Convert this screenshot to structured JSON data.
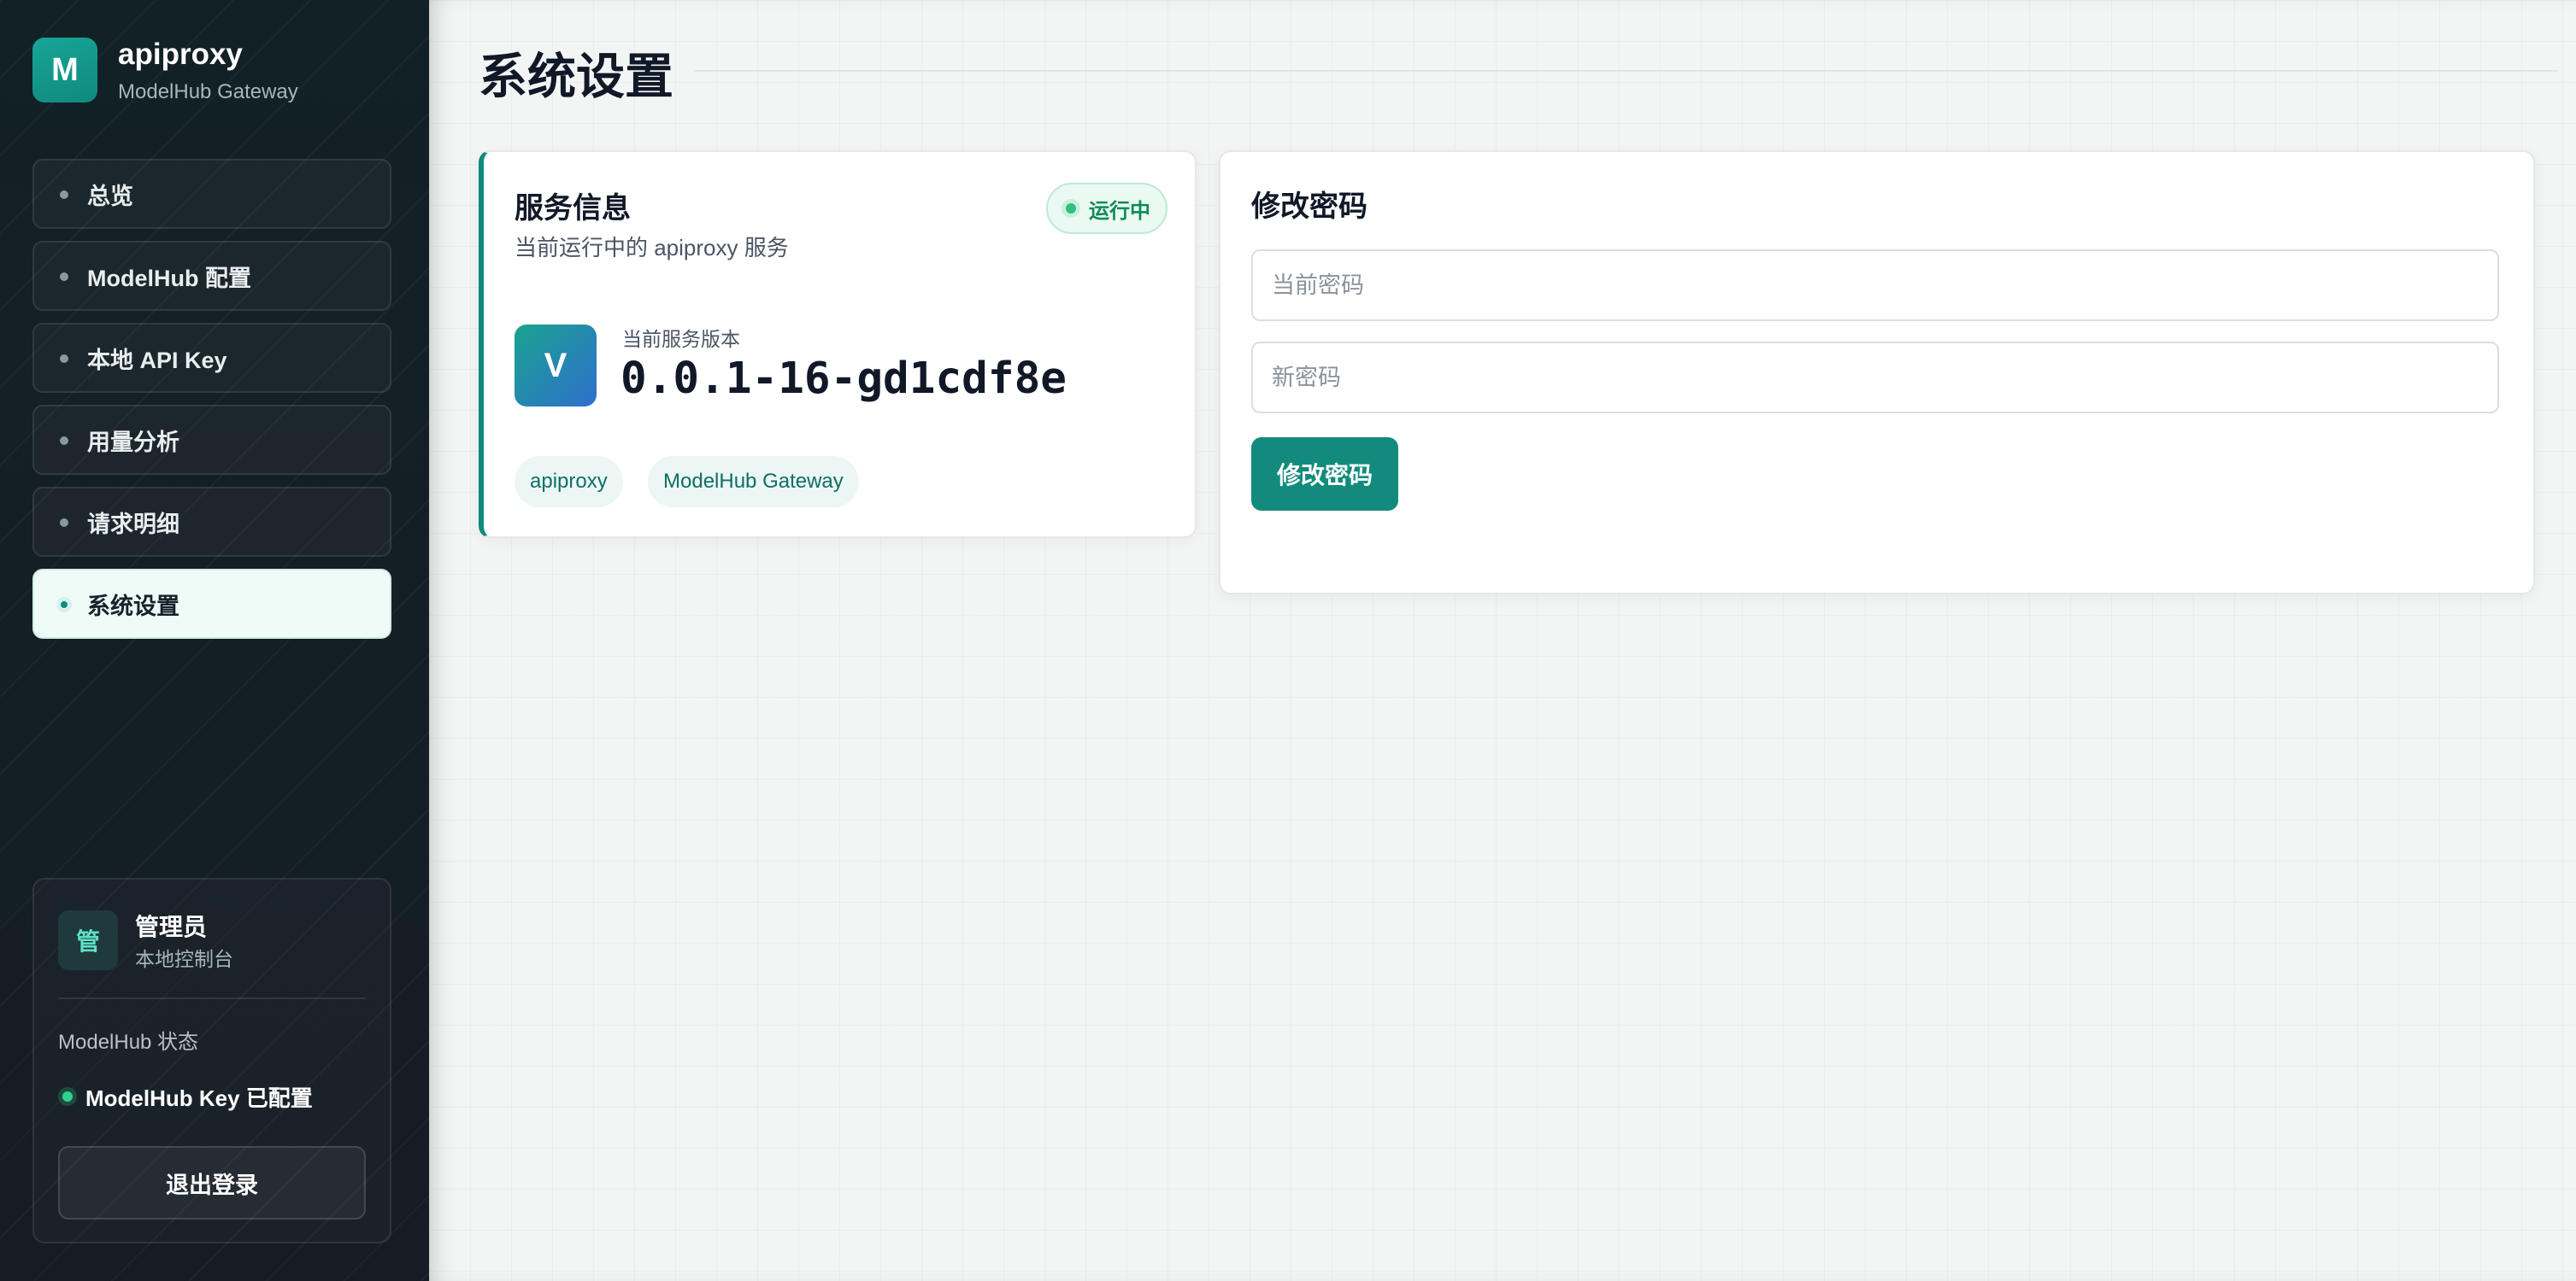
{
  "brand": {
    "logo_letter": "M",
    "name": "apiproxy",
    "subtitle": "ModelHub Gateway"
  },
  "sidebar": {
    "items": [
      {
        "label": "总览",
        "active": false
      },
      {
        "label": "ModelHub 配置",
        "active": false
      },
      {
        "label": "本地 API Key",
        "active": false
      },
      {
        "label": "用量分析",
        "active": false
      },
      {
        "label": "请求明细",
        "active": false
      },
      {
        "label": "系统设置",
        "active": true
      }
    ]
  },
  "user": {
    "avatar_char": "管",
    "name": "管理员",
    "role": "本地控制台",
    "modelhub_title": "ModelHub 状态",
    "modelhub_status": "ModelHub Key 已配置",
    "logout_label": "退出登录"
  },
  "page": {
    "title": "系统设置"
  },
  "service": {
    "title": "服务信息",
    "subtitle": "当前运行中的 apiproxy 服务",
    "status_badge": "运行中",
    "version_icon": "V",
    "version_label": "当前服务版本",
    "version_value": "0.0.1-16-gd1cdf8e",
    "tags": [
      "apiproxy",
      "ModelHub Gateway"
    ]
  },
  "password": {
    "title": "修改密码",
    "current_placeholder": "当前密码",
    "current_value": "",
    "new_placeholder": "新密码",
    "new_value": "",
    "submit_label": "修改密码"
  },
  "colors": {
    "accent": "#0f8a7d",
    "status_green": "#2fbf7f",
    "sidebar_bg": "#141f25"
  }
}
